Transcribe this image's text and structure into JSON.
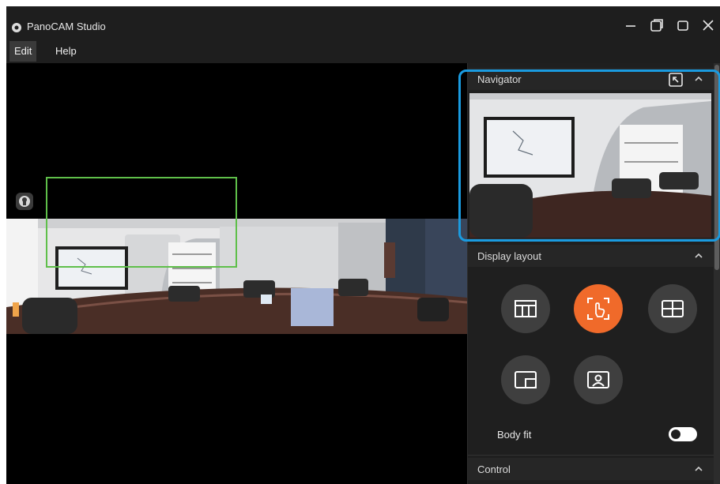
{
  "app": {
    "title": "PanoCAM Studio"
  },
  "menu": {
    "items": [
      {
        "label": "Edit"
      },
      {
        "label": "Help"
      }
    ]
  },
  "navigator": {
    "title": "Navigator"
  },
  "display_layout": {
    "title": "Display layout",
    "buttons": [
      {
        "icon": "table-layout-icon"
      },
      {
        "icon": "hand-select-icon",
        "active": true
      },
      {
        "icon": "grid-layout-icon"
      },
      {
        "icon": "picture-in-picture-icon"
      },
      {
        "icon": "presenter-icon"
      }
    ]
  },
  "body_fit": {
    "label": "Body fit",
    "enabled": false
  },
  "control": {
    "title": "Control"
  },
  "colors": {
    "accent": "#f06a2a",
    "highlight": "#1a9be0",
    "selection": "#5fbf4a"
  }
}
